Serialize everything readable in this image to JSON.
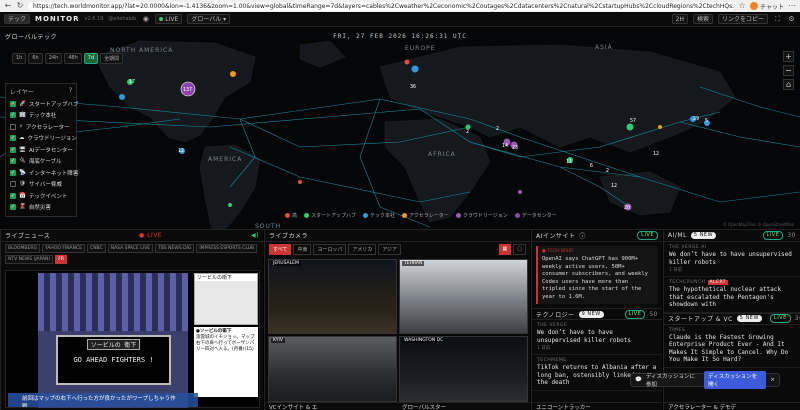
{
  "browser": {
    "url": "https://tech.worldmonitor.app/?lat=20.0000&lon=-1.4136&zoom=1.00&view=global&timeRange=7d&layers=cables%2Cweather%2Ceconomic%2Coutages%2Cdatacenters%2Cnatural%2CstartupHubs%2CcloudRegions%2CtechHQs...",
    "profile": "チャット"
  },
  "topbar": {
    "tag": "テック",
    "brand": "MONITOR",
    "version": "v2.6.19",
    "handle": "@eliehabib",
    "live_label": "LIVE",
    "region_select": "グローバル ▾",
    "counter": "2H",
    "search_label": "検索",
    "copy_link": "リンクをコピー"
  },
  "map": {
    "title": "グローバルテック",
    "datetime": "FRI, 27 FEB 2026 16:26:31 UTC",
    "time_buttons": [
      "1h",
      "6h",
      "24h",
      "48h",
      "7d",
      "全期間"
    ],
    "active_time": "7d",
    "layers_title": "レイヤー",
    "layers_close": "?",
    "layers": [
      {
        "label": "スタートアップハブ",
        "on": true,
        "icon": "🚀"
      },
      {
        "label": "テック本社",
        "on": true,
        "icon": "🏢"
      },
      {
        "label": "アクセラレーター",
        "on": false,
        "icon": "⚡"
      },
      {
        "label": "クラウドリージョン",
        "on": true,
        "icon": "☁"
      },
      {
        "label": "AIデータセンター",
        "on": true,
        "icon": "🖥"
      },
      {
        "label": "海底ケーブル",
        "on": true,
        "icon": "🔌"
      },
      {
        "label": "インターネット障害",
        "on": true,
        "icon": "📡"
      },
      {
        "label": "サイバー脅威",
        "on": false,
        "icon": "🛡"
      },
      {
        "label": "テックイベント",
        "on": true,
        "icon": "📅"
      },
      {
        "label": "自然災害",
        "on": true,
        "icon": "🌋"
      }
    ],
    "region_labels": [
      "NORTH AMERICA",
      "EUROPE",
      "ASIA",
      "AFRICA",
      "AMERICA",
      "SOUTH"
    ],
    "cluster_counts": [
      "17",
      "137",
      "12",
      "36",
      "2",
      "2",
      "14",
      "23",
      "57",
      "12",
      "29",
      "5",
      "11",
      "6",
      "12",
      "2",
      "20"
    ],
    "legend": [
      {
        "label": "高",
        "color": "#e74c3c"
      },
      {
        "label": "スタートアップハブ",
        "color": "#2ecc71"
      },
      {
        "label": "テック本社",
        "color": "#3498db"
      },
      {
        "label": "アクセラレーター",
        "color": "#f39c12"
      },
      {
        "label": "クラウドリージョン",
        "color": "#9b59b6"
      },
      {
        "label": "データセンター",
        "color": "#8e44ad"
      }
    ],
    "attribution": "© OpenMapTiles © OpenStreetMap"
  },
  "live_news": {
    "title": "ライブニュース",
    "live": "LIVE",
    "channels": [
      "BLOOMBERG",
      "YAHOO FINANCE",
      "CNBC",
      "NASA SPACE LIVE",
      "TBS NEWS DIG",
      "IMPRESS ESPORTS CLUB",
      "NTV NEWS (JAPAN)",
      "FR"
    ],
    "active_channel": "FR",
    "video_caption_1": "ソービルの 衛下",
    "video_caption_2": "GO AHEAD FIGHTERS !",
    "video_right_1": "ソービルの衛下",
    "video_right_2": "●ソービルの衛下",
    "video_desc": "溶雲城のイチジョッ。マップ右下の扉へ行ってボーザンパリー四対へ入る。(月番)(15)",
    "video_bottom": "前回はマップの右下へ行った方が良かったがワープしちゃう作戦..."
  },
  "live_cams": {
    "title": "ライブカメラ",
    "tabs": [
      "すべて",
      "中東",
      "ヨーロッパ",
      "アメリカ",
      "アジア"
    ],
    "active_tab": "すべて",
    "cams": [
      "JERUSALEM",
      "TEHRAN",
      "KYIV",
      "WASHINGTON DC"
    ]
  },
  "ai_insights": {
    "title": "AIインサイト",
    "info": "ⓘ",
    "live": "LIVE",
    "brief_label": "TECH BRIEF",
    "brief_text": "OpenAI says ChatGPT has 900M+ weekly active users, 50M+ consumer subscribers, and weekly Codex users have more than tripled since the start of the year to 1.6M.",
    "tech_title": "テクノロジー",
    "tech_new": "9 NEW",
    "tech_live": "LIVE",
    "tech_count": "50",
    "tech_items": [
      {
        "src": "THE VERGE",
        "title": "We don&#8217;t have to have unsupervised killer robots",
        "meta": "1 日前"
      },
      {
        "src": "TECHMEME",
        "title": "TikTok returns to Albania after a long ban, ostensibly linked to the death",
        "meta": ""
      }
    ],
    "bottom_panel": "ユニコーントラッカー"
  },
  "ai_ml": {
    "title": "AI/ML",
    "new": "5 NEW",
    "live": "LIVE",
    "count": "30",
    "items": [
      {
        "src": "THE VERGE AI",
        "title": "We don&#8217;t have to have unsupervised killer robots",
        "meta": "1 日前",
        "alert": ""
      },
      {
        "src": "TECHCRUNCH",
        "title": "The hypothetical nuclear attack that escalated the Pentagon's showdown with",
        "meta": "",
        "alert": "ALERT"
      }
    ],
    "startups_title": "スタートアップ & VC",
    "startups_new": "5 NEW",
    "startups_live": "LIVE",
    "startups_count": "30",
    "startup_items": [
      {
        "src": "TIMES",
        "title": "Claude is the Fastest Growing Enterprise Product Ever - And It Makes It Simple to Cancel. Why Do You Make It So Hard?",
        "meta": ""
      }
    ],
    "bottom_panel": "アクセラレーター & デモデ"
  },
  "discussion": {
    "prompt": "ディスカッションに参加",
    "button": "ディスカッションを開く",
    "close": "×"
  },
  "bottom_labels": {
    "vc": "VCインサイト & エ",
    "global": "グローバルスター"
  }
}
